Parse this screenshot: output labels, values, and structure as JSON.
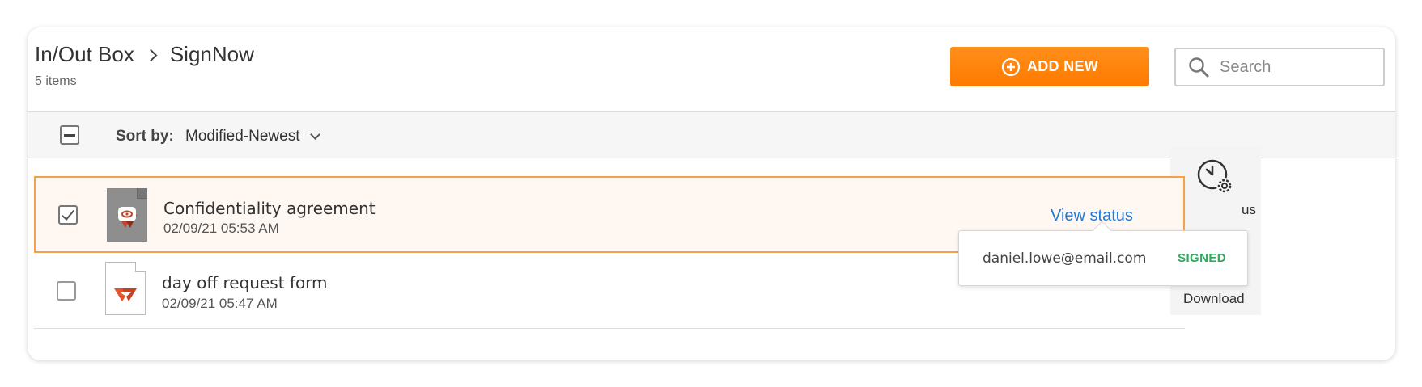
{
  "header": {
    "breadcrumb": [
      "In/Out Box",
      "SignNow"
    ],
    "item_count": "5 items",
    "add_new_label": "ADD NEW"
  },
  "search": {
    "placeholder": "Search",
    "value": ""
  },
  "sortbar": {
    "label": "Sort by:",
    "value": "Modified-Newest"
  },
  "documents": [
    {
      "name": "Confidentiality agreement",
      "date": "02/09/21 05:53 AM",
      "checked": true,
      "action_label": "View status"
    },
    {
      "name": "day off request form",
      "date": "02/09/21 05:47 AM",
      "checked": false
    }
  ],
  "popover": {
    "email": "daniel.lowe@email.com",
    "status": "SIGNED"
  },
  "side_actions": {
    "status_label": "us",
    "download_label": "Download"
  },
  "colors": {
    "accent": "#ff8200",
    "link": "#1e7ad9",
    "signed": "#2faa5c",
    "selected_border": "#f5a04a",
    "brand_red": "#e8532a"
  },
  "icons": [
    "plus-circle-icon",
    "search-icon",
    "signnow-logo-icon",
    "clock-gear-icon",
    "download-doc-icon",
    "chevron-down-icon"
  ]
}
